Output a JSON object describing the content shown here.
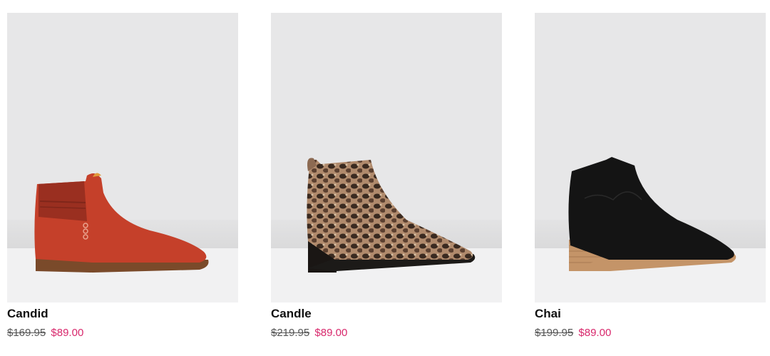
{
  "products": [
    {
      "name": "Candid",
      "price_original": "$169.95",
      "price_sale": "$89.00",
      "image_icon": "red-suede-ankle-boot",
      "color": "#c5402a"
    },
    {
      "name": "Candle",
      "price_original": "$219.95",
      "price_sale": "$89.00",
      "image_icon": "snakeskin-ankle-boot",
      "color": "#8a6a50"
    },
    {
      "name": "Chai",
      "price_original": "$199.95",
      "price_sale": "$89.00",
      "image_icon": "black-suede-western-boot",
      "color": "#141414"
    }
  ],
  "colors": {
    "sale_price": "#d8286c",
    "original_price": "#555555",
    "image_background": "#e7e7e8"
  }
}
